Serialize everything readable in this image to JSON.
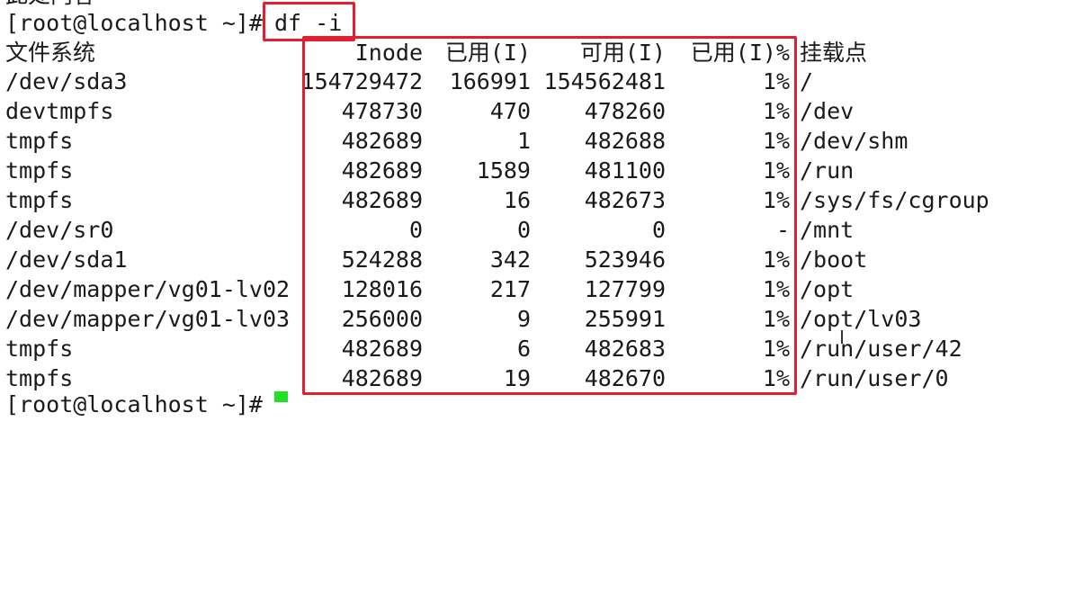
{
  "terminal": {
    "top_cut_text": "此处内容",
    "prompt": "[root@localhost ~]#",
    "command": "df -i",
    "next_prompt": "[root@localhost ~]#",
    "header": {
      "filesystem": "文件系统",
      "inodes": "Inode",
      "used": "已用(I)",
      "free": "可用(I)",
      "use_pct": "已用(I)%",
      "mounted_on": "挂载点"
    },
    "rows": [
      {
        "filesystem": "/dev/sda3",
        "inodes": "154729472",
        "used": "166991",
        "free": "154562481",
        "use_pct": "1%",
        "mounted_on": "/"
      },
      {
        "filesystem": "devtmpfs",
        "inodes": "478730",
        "used": "470",
        "free": "478260",
        "use_pct": "1%",
        "mounted_on": "/dev"
      },
      {
        "filesystem": "tmpfs",
        "inodes": "482689",
        "used": "1",
        "free": "482688",
        "use_pct": "1%",
        "mounted_on": "/dev/shm"
      },
      {
        "filesystem": "tmpfs",
        "inodes": "482689",
        "used": "1589",
        "free": "481100",
        "use_pct": "1%",
        "mounted_on": "/run"
      },
      {
        "filesystem": "tmpfs",
        "inodes": "482689",
        "used": "16",
        "free": "482673",
        "use_pct": "1%",
        "mounted_on": "/sys/fs/cgroup"
      },
      {
        "filesystem": "/dev/sr0",
        "inodes": "0",
        "used": "0",
        "free": "0",
        "use_pct": "-",
        "mounted_on": "/mnt"
      },
      {
        "filesystem": "/dev/sda1",
        "inodes": "524288",
        "used": "342",
        "free": "523946",
        "use_pct": "1%",
        "mounted_on": "/boot"
      },
      {
        "filesystem": "/dev/mapper/vg01-lv02",
        "inodes": "128016",
        "used": "217",
        "free": "127799",
        "use_pct": "1%",
        "mounted_on": "/opt"
      },
      {
        "filesystem": "/dev/mapper/vg01-lv03",
        "inodes": "256000",
        "used": "9",
        "free": "255991",
        "use_pct": "1%",
        "mounted_on": "/opt/lv03"
      },
      {
        "filesystem": "tmpfs",
        "inodes": "482689",
        "used": "6",
        "free": "482683",
        "use_pct": "1%",
        "mounted_on": "/run/user/42"
      },
      {
        "filesystem": "tmpfs",
        "inodes": "482689",
        "used": "19",
        "free": "482670",
        "use_pct": "1%",
        "mounted_on": "/run/user/0"
      }
    ]
  },
  "colors": {
    "highlight": "#e0202f",
    "cursor": "#22e022",
    "text": "#1a1a1a",
    "background": "#ffffff"
  }
}
